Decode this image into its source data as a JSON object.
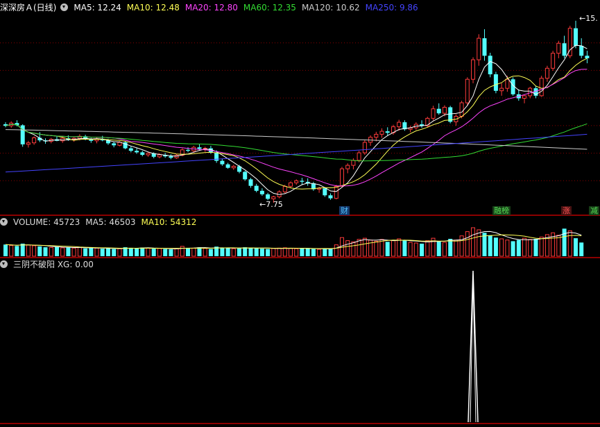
{
  "stock": {
    "name": "深深房Ａ(日线)",
    "ma_labels": [
      {
        "text": "MA5: 12.24",
        "color": "#ffffff"
      },
      {
        "text": "MA10: 12.48",
        "color": "#ffff55"
      },
      {
        "text": "MA20: 12.80",
        "color": "#ff44ff"
      },
      {
        "text": "MA60: 12.35",
        "color": "#33dd33"
      },
      {
        "text": "MA120: 10.62",
        "color": "#cccccc"
      },
      {
        "text": "MA250: 9.86",
        "color": "#4444ff"
      }
    ]
  },
  "volume": {
    "labels": [
      {
        "text": "VOLUME: 45723",
        "color": "#dddddd"
      },
      {
        "text": "MA5: 46503",
        "color": "#dddddd"
      },
      {
        "text": "MA10: 54312",
        "color": "#ffff55"
      }
    ]
  },
  "indicator": {
    "labels": [
      {
        "text": "三阴不破阳 XG: 0.00",
        "color": "#dddddd"
      }
    ]
  },
  "annotations": {
    "low_value": "7.75",
    "high_value": "15.",
    "events": [
      {
        "text": "财",
        "color": "#4fc3ff"
      },
      {
        "text": "融榜",
        "color": "#55dd55"
      },
      {
        "text": "涨",
        "color": "#ff5555"
      },
      {
        "text": "减",
        "color": "#55dd55"
      }
    ]
  },
  "colors": {
    "up": "#ff3b3b",
    "down": "#54ffff",
    "grid": "#8b0000",
    "ma5": "#ffffff",
    "ma10": "#ffff55",
    "ma20": "#ff44ff",
    "ma60": "#33dd33",
    "ma120": "#cccccc",
    "ma250": "#4444ff"
  },
  "chart_data": {
    "type": "candlestick",
    "candles": [
      [
        13.26,
        13.34,
        13.14,
        13.2
      ],
      [
        13.2,
        13.38,
        13.12,
        13.31
      ],
      [
        13.31,
        13.42,
        13.18,
        13.22
      ],
      [
        13.22,
        13.26,
        12.36,
        12.46
      ],
      [
        12.46,
        12.6,
        12.33,
        12.52
      ],
      [
        12.52,
        12.78,
        12.44,
        12.72
      ],
      [
        12.72,
        12.95,
        12.55,
        12.62
      ],
      [
        12.62,
        12.7,
        12.48,
        12.58
      ],
      [
        12.58,
        12.72,
        12.5,
        12.66
      ],
      [
        12.66,
        12.78,
        12.58,
        12.6
      ],
      [
        12.6,
        12.76,
        12.52,
        12.7
      ],
      [
        12.7,
        12.82,
        12.6,
        12.64
      ],
      [
        12.64,
        12.74,
        12.56,
        12.7
      ],
      [
        12.7,
        12.86,
        12.62,
        12.78
      ],
      [
        12.78,
        12.84,
        12.62,
        12.66
      ],
      [
        12.66,
        12.72,
        12.52,
        12.6
      ],
      [
        12.6,
        12.74,
        12.5,
        12.68
      ],
      [
        12.68,
        12.8,
        12.58,
        12.62
      ],
      [
        12.62,
        12.68,
        12.44,
        12.5
      ],
      [
        12.5,
        12.56,
        12.34,
        12.42
      ],
      [
        12.42,
        12.58,
        12.38,
        12.54
      ],
      [
        12.54,
        12.58,
        12.26,
        12.3
      ],
      [
        12.3,
        12.38,
        12.14,
        12.2
      ],
      [
        12.2,
        12.3,
        12.08,
        12.14
      ],
      [
        12.14,
        12.2,
        11.98,
        12.04
      ],
      [
        12.04,
        12.16,
        11.96,
        12.1
      ],
      [
        12.1,
        12.14,
        11.9,
        11.96
      ],
      [
        11.96,
        12.1,
        11.9,
        12.04
      ],
      [
        12.04,
        12.12,
        11.92,
        11.98
      ],
      [
        11.98,
        12.06,
        11.86,
        11.92
      ],
      [
        11.92,
        12.08,
        11.88,
        12.02
      ],
      [
        12.02,
        12.3,
        11.98,
        12.24
      ],
      [
        12.24,
        12.34,
        12.14,
        12.2
      ],
      [
        12.2,
        12.4,
        12.12,
        12.34
      ],
      [
        12.34,
        12.46,
        12.22,
        12.28
      ],
      [
        12.28,
        12.36,
        12.16,
        12.3
      ],
      [
        12.3,
        12.4,
        12.08,
        12.12
      ],
      [
        12.12,
        12.22,
        11.72,
        11.8
      ],
      [
        11.8,
        11.88,
        11.6,
        11.66
      ],
      [
        11.66,
        11.72,
        11.48,
        11.52
      ],
      [
        11.52,
        11.64,
        11.44,
        11.58
      ],
      [
        11.58,
        11.64,
        11.3,
        11.36
      ],
      [
        11.36,
        11.4,
        11.0,
        11.06
      ],
      [
        11.06,
        11.12,
        10.72,
        10.8
      ],
      [
        10.8,
        10.88,
        10.54,
        10.6
      ],
      [
        10.6,
        10.7,
        10.4,
        10.46
      ],
      [
        10.46,
        10.52,
        10.22,
        10.28
      ],
      [
        10.28,
        10.4,
        10.12,
        10.36
      ],
      [
        10.36,
        10.62,
        10.3,
        10.56
      ],
      [
        10.56,
        10.84,
        10.5,
        10.78
      ],
      [
        10.78,
        10.98,
        10.72,
        10.92
      ],
      [
        10.92,
        11.06,
        10.84,
        11.0
      ],
      [
        11.0,
        11.12,
        10.86,
        10.96
      ],
      [
        10.96,
        11.1,
        10.8,
        10.9
      ],
      [
        10.9,
        10.96,
        10.6,
        10.66
      ],
      [
        10.66,
        10.76,
        10.52,
        10.7
      ],
      [
        10.7,
        10.74,
        10.36,
        10.42
      ],
      [
        10.42,
        10.5,
        10.24,
        10.3
      ],
      [
        10.3,
        10.84,
        10.26,
        10.78
      ],
      [
        10.78,
        11.56,
        10.74,
        11.48
      ],
      [
        11.48,
        11.7,
        11.3,
        11.62
      ],
      [
        11.62,
        11.9,
        11.46,
        11.82
      ],
      [
        11.82,
        12.2,
        11.74,
        12.12
      ],
      [
        12.12,
        12.62,
        12.04,
        12.54
      ],
      [
        12.54,
        12.82,
        12.4,
        12.74
      ],
      [
        12.74,
        12.96,
        12.58,
        12.86
      ],
      [
        12.86,
        13.1,
        12.72,
        12.98
      ],
      [
        12.98,
        13.14,
        12.82,
        12.92
      ],
      [
        12.92,
        13.24,
        12.84,
        13.16
      ],
      [
        13.16,
        13.44,
        13.0,
        13.34
      ],
      [
        13.34,
        13.42,
        13.0,
        13.06
      ],
      [
        13.06,
        13.2,
        12.94,
        13.12
      ],
      [
        13.12,
        13.34,
        13.04,
        13.26
      ],
      [
        13.26,
        13.42,
        13.12,
        13.2
      ],
      [
        13.2,
        13.56,
        13.14,
        13.5
      ],
      [
        13.5,
        14.0,
        13.42,
        13.88
      ],
      [
        13.88,
        14.1,
        13.64,
        13.7
      ],
      [
        13.7,
        14.02,
        13.58,
        13.94
      ],
      [
        13.94,
        14.0,
        13.3,
        13.36
      ],
      [
        13.36,
        13.66,
        13.2,
        13.58
      ],
      [
        13.58,
        14.2,
        13.5,
        14.12
      ],
      [
        14.12,
        15.14,
        14.0,
        15.06
      ],
      [
        15.06,
        15.94,
        14.9,
        15.84
      ],
      [
        15.84,
        16.86,
        15.6,
        16.7
      ],
      [
        16.7,
        17.06,
        15.8,
        16.0
      ],
      [
        16.0,
        16.12,
        15.14,
        15.26
      ],
      [
        15.26,
        15.36,
        14.5,
        14.6
      ],
      [
        14.6,
        14.9,
        14.4,
        14.7
      ],
      [
        14.7,
        15.2,
        14.56,
        15.06
      ],
      [
        15.06,
        15.14,
        14.4,
        14.46
      ],
      [
        14.46,
        14.66,
        14.2,
        14.3
      ],
      [
        14.3,
        14.46,
        14.1,
        14.4
      ],
      [
        14.4,
        14.76,
        14.3,
        14.7
      ],
      [
        14.7,
        14.8,
        14.3,
        14.4
      ],
      [
        14.4,
        15.2,
        14.36,
        15.1
      ],
      [
        15.1,
        15.6,
        14.96,
        15.5
      ],
      [
        15.5,
        16.2,
        15.4,
        16.1
      ],
      [
        16.1,
        16.6,
        15.9,
        16.5
      ],
      [
        16.5,
        16.8,
        15.9,
        16.0
      ],
      [
        16.0,
        17.2,
        15.9,
        17.1
      ],
      [
        17.1,
        17.4,
        16.3,
        16.4
      ],
      [
        16.4,
        16.7,
        15.9,
        16.0
      ],
      [
        16.0,
        16.2,
        15.7,
        15.9
      ]
    ],
    "volumes": [
      39000,
      36000,
      34000,
      42000,
      37000,
      35000,
      33000,
      30000,
      29000,
      31000,
      28000,
      30000,
      27000,
      29000,
      26000,
      28000,
      27000,
      25000,
      26000,
      24000,
      25000,
      30000,
      28000,
      26000,
      29000,
      27000,
      25000,
      26000,
      24000,
      23000,
      25000,
      33000,
      28000,
      27000,
      30000,
      26000,
      24000,
      32000,
      28000,
      27000,
      25000,
      26000,
      30000,
      29000,
      27000,
      25000,
      24000,
      26000,
      27000,
      28000,
      26000,
      25000,
      27000,
      26000,
      24000,
      23000,
      25000,
      24000,
      38000,
      62000,
      52000,
      48000,
      56000,
      60000,
      54000,
      50000,
      56000,
      48000,
      52000,
      58000,
      54000,
      46000,
      44000,
      42000,
      52000,
      60000,
      50000,
      46000,
      58000,
      54000,
      68000,
      82000,
      95000,
      88000,
      78000,
      70000,
      62000,
      58000,
      54000,
      50000,
      54000,
      60000,
      56000,
      58000,
      64000,
      72000,
      78000,
      70000,
      92000,
      85000,
      60000,
      45723
    ],
    "ma_last": {
      "MA5": 12.24,
      "MA10": 12.48,
      "MA20": 12.8,
      "MA60": 12.35,
      "MA120": 10.62,
      "MA250": 9.86
    },
    "volume_ma_last": {
      "MA5": 46503,
      "MA10": 54312
    },
    "ma120": [
      13.05,
      12.26
    ],
    "ma250": [
      11.35,
      12.86
    ],
    "xg_signal_index": 82,
    "xg_value": 0.0
  }
}
